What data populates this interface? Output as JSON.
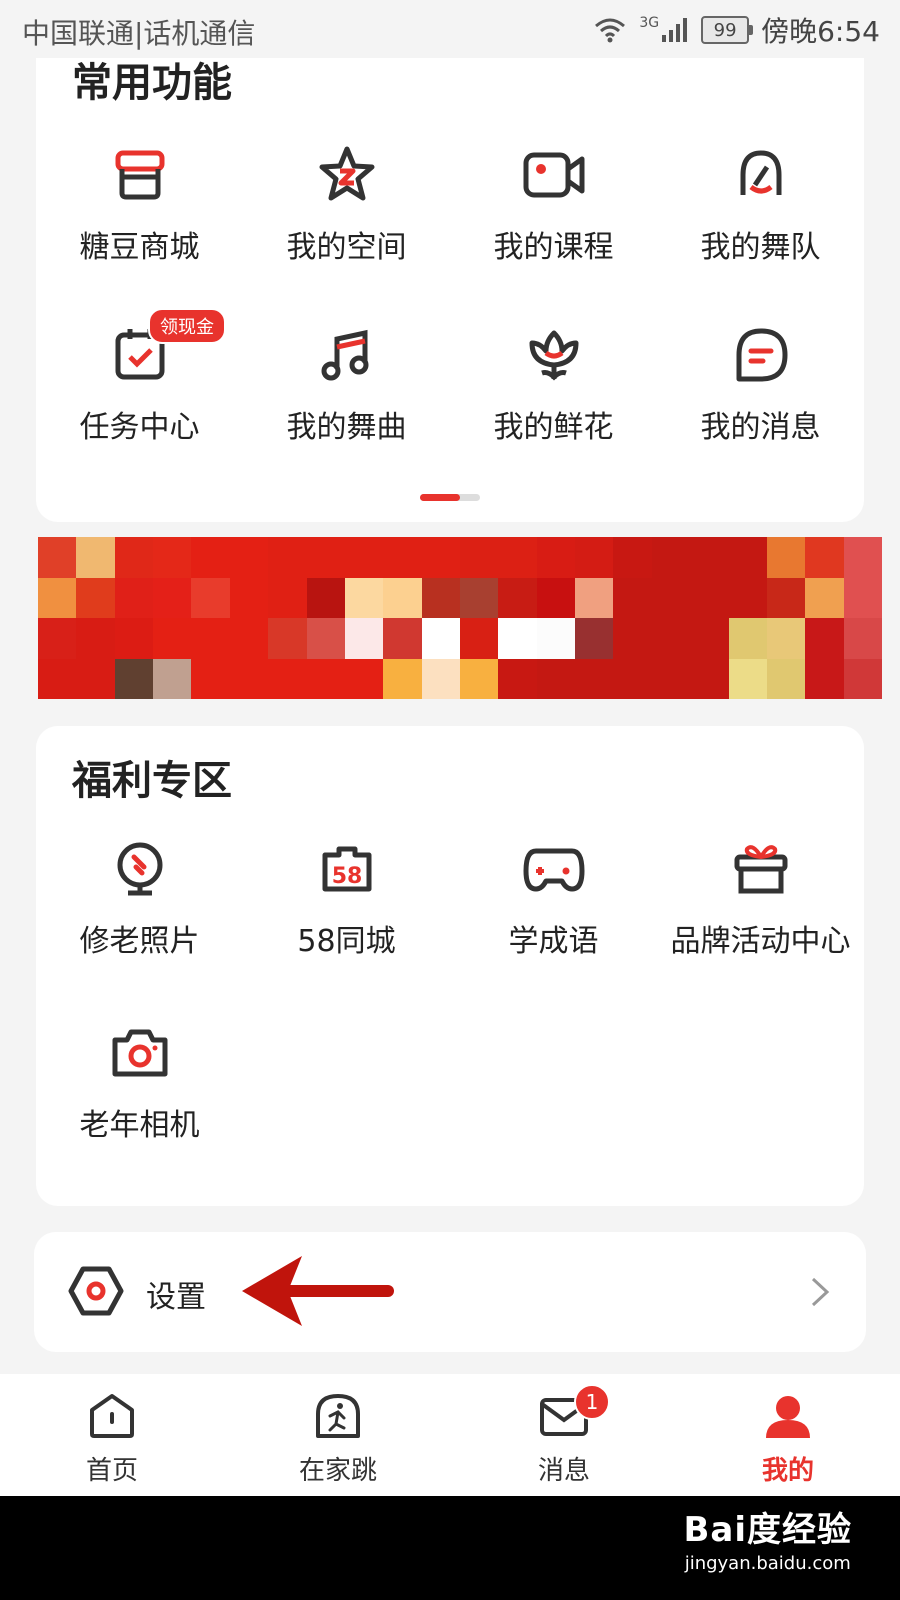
{
  "status_bar": {
    "carrier": "中国联通|话机通信",
    "network": "3G",
    "battery": "99",
    "time": "傍晚6:54"
  },
  "common": {
    "title": "常用功能",
    "items": [
      {
        "label": "糖豆商城",
        "icon": "shop-icon"
      },
      {
        "label": "我的空间",
        "icon": "star-icon"
      },
      {
        "label": "我的课程",
        "icon": "video-camera-icon"
      },
      {
        "label": "我的舞队",
        "icon": "dance-team-icon"
      },
      {
        "label": "任务中心",
        "icon": "task-calendar-icon",
        "badge": "领现金"
      },
      {
        "label": "我的舞曲",
        "icon": "music-note-icon"
      },
      {
        "label": "我的鲜花",
        "icon": "flower-icon"
      },
      {
        "label": "我的消息",
        "icon": "chat-bubble-icon"
      }
    ]
  },
  "welfare": {
    "title": "福利专区",
    "items": [
      {
        "label": "修老照片",
        "icon": "photo-restore-icon"
      },
      {
        "label": "58同城",
        "icon": "58-city-icon"
      },
      {
        "label": "学成语",
        "icon": "gamepad-icon"
      },
      {
        "label": "品牌活动中心",
        "icon": "gift-icon"
      },
      {
        "label": "老年相机",
        "icon": "camera-icon"
      }
    ]
  },
  "settings": {
    "label": "设置",
    "icon": "settings-icon"
  },
  "bottom_nav": {
    "items": [
      {
        "label": "首页",
        "icon": "home-icon"
      },
      {
        "label": "在家跳",
        "icon": "dance-icon"
      },
      {
        "label": "消息",
        "icon": "mail-icon",
        "badge": "1"
      },
      {
        "label": "我的",
        "icon": "profile-icon",
        "active": true
      }
    ]
  },
  "watermark": {
    "brand": "Bai度经验",
    "url": "jingyan.baidu.com"
  },
  "colors": {
    "accent": "#e8332d",
    "icon_stroke": "#333333",
    "background": "#f4f4f4"
  }
}
